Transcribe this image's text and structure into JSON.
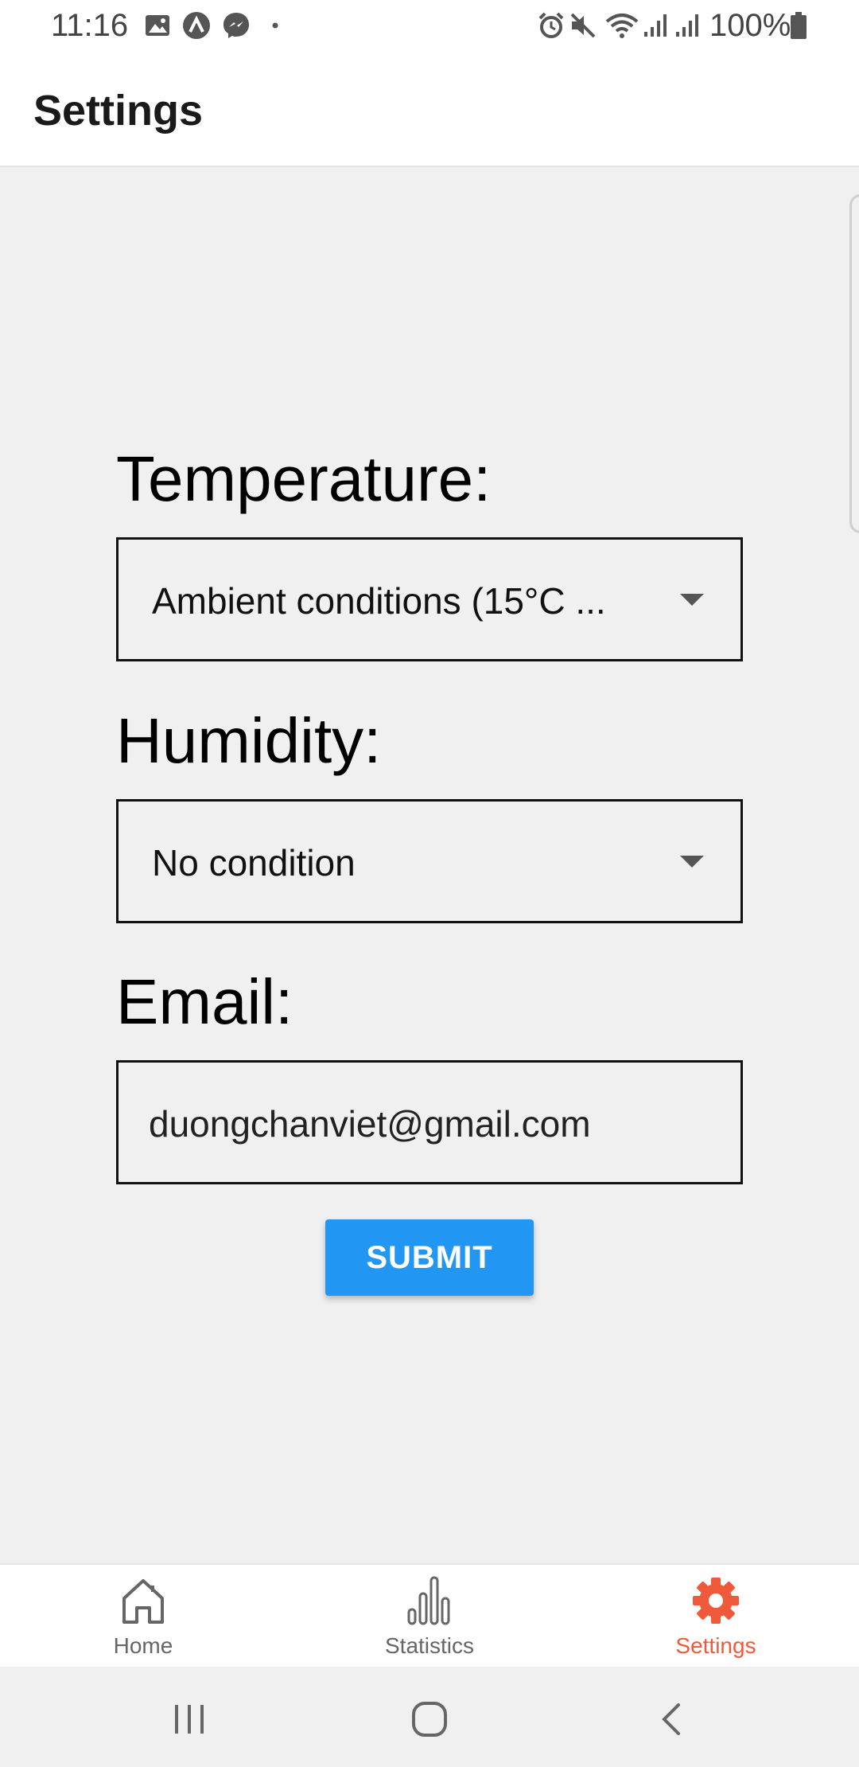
{
  "status_bar": {
    "time": "11:16",
    "battery_text": "100%",
    "left_icons": [
      "gallery-icon",
      "app-arc-icon",
      "messenger-icon",
      "dot-icon"
    ],
    "right_icons": [
      "alarm-icon",
      "mute-icon",
      "wifi-icon",
      "signal-icon",
      "signal-icon",
      "battery-icon"
    ]
  },
  "app_bar": {
    "title": "Settings"
  },
  "form": {
    "temperature": {
      "label": "Temperature:",
      "selected": "Ambient conditions (15°C ..."
    },
    "humidity": {
      "label": "Humidity:",
      "selected": "No condition"
    },
    "email": {
      "label": "Email:",
      "value": "duongchanviet@gmail.com"
    },
    "submit_label": "SUBMIT"
  },
  "bottom_nav": {
    "items": [
      {
        "label": "Home",
        "icon": "home-icon",
        "active": false
      },
      {
        "label": "Statistics",
        "icon": "bar-chart-icon",
        "active": false
      },
      {
        "label": "Settings",
        "icon": "gear-icon",
        "active": true
      }
    ]
  },
  "colors": {
    "accent": "#2196f3",
    "active_tab": "#f0593a",
    "background": "#f0f0f0"
  },
  "system_nav": {
    "buttons": [
      "recent-apps-icon",
      "home-circle-icon",
      "back-icon"
    ]
  }
}
